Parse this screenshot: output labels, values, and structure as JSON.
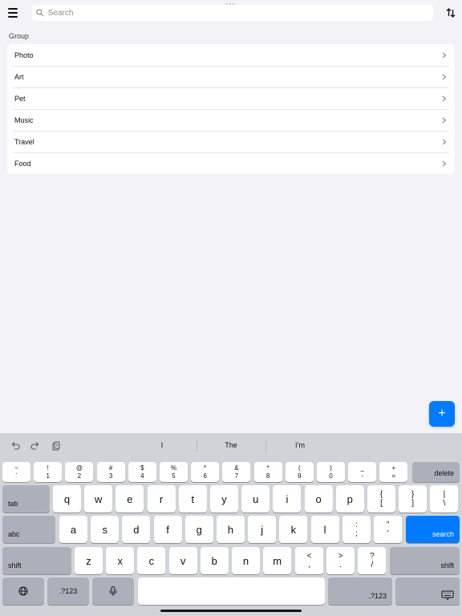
{
  "search": {
    "placeholder": "Search"
  },
  "group": {
    "label": "Group",
    "items": [
      {
        "label": "Photo"
      },
      {
        "label": "Art"
      },
      {
        "label": "Pet"
      },
      {
        "label": "Music"
      },
      {
        "label": "Travel"
      },
      {
        "label": "Food"
      }
    ]
  },
  "fab": {
    "label": "+"
  },
  "keyboard": {
    "suggestions": [
      "I",
      "The",
      "I’m"
    ],
    "number_row": [
      {
        "top": "~",
        "bottom": "`"
      },
      {
        "top": "!",
        "bottom": "1"
      },
      {
        "top": "@",
        "bottom": "2"
      },
      {
        "top": "#",
        "bottom": "3"
      },
      {
        "top": "$",
        "bottom": "4"
      },
      {
        "top": "%",
        "bottom": "5"
      },
      {
        "top": "^",
        "bottom": "6"
      },
      {
        "top": "&",
        "bottom": "7"
      },
      {
        "top": "*",
        "bottom": "8"
      },
      {
        "top": "(",
        "bottom": "9"
      },
      {
        "top": ")",
        "bottom": "0"
      },
      {
        "top": "_",
        "bottom": "-"
      },
      {
        "top": "+",
        "bottom": "="
      }
    ],
    "delete_label": "delete",
    "tab_label": "tab",
    "row_q": [
      "q",
      "w",
      "e",
      "r",
      "t",
      "y",
      "u",
      "i",
      "o",
      "p"
    ],
    "row_q_symbols": [
      {
        "top": "{",
        "bottom": "["
      },
      {
        "top": "}",
        "bottom": "]"
      },
      {
        "top": "|",
        "bottom": "\\"
      }
    ],
    "abc_label": "abc",
    "row_a": [
      "a",
      "s",
      "d",
      "f",
      "g",
      "h",
      "j",
      "k",
      "l"
    ],
    "row_a_symbols": [
      {
        "top": ":",
        "bottom": ";"
      },
      {
        "top": "\"",
        "bottom": "'"
      }
    ],
    "search_label": "search",
    "shift_label": "shift",
    "row_z": [
      "z",
      "x",
      "c",
      "v",
      "b",
      "n",
      "m"
    ],
    "row_z_symbols": [
      {
        "top": "<",
        "bottom": ","
      },
      {
        "top": ">",
        "bottom": "."
      },
      {
        "top": "?",
        "bottom": "/"
      }
    ],
    "numbers_label": ".?123",
    "colors": {
      "accent": "#007aff",
      "key_dark": "#abb0bb",
      "keyboard_bg": "#d1d3d9"
    }
  }
}
